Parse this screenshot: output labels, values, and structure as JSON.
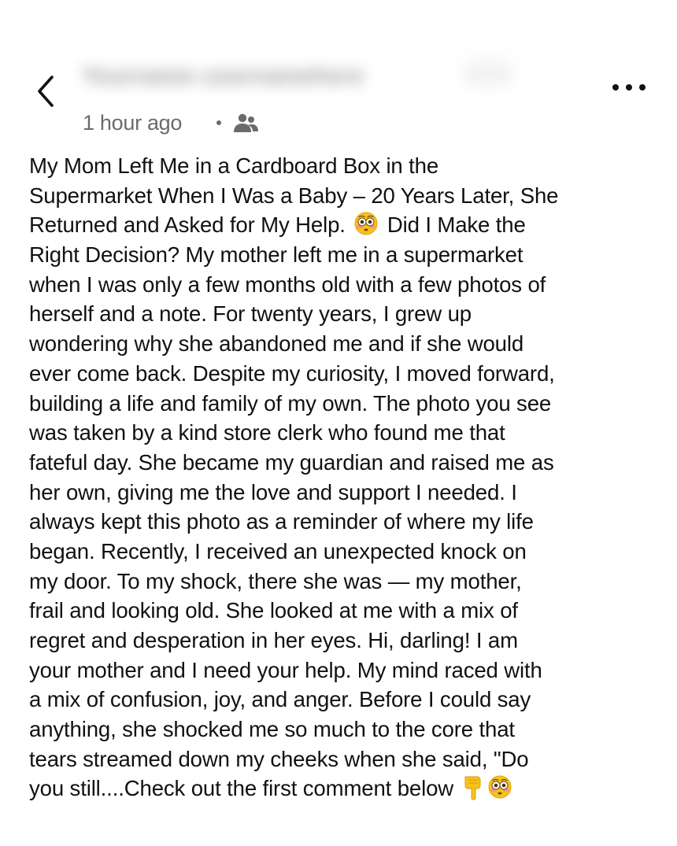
{
  "header": {
    "back_icon": "chevron-left-icon",
    "author_name_blurred": "Yourname usernamehere",
    "more_icon": "more-horizontal-icon",
    "timestamp": "1 hour ago",
    "audience_icon": "friends-icon"
  },
  "post": {
    "lines": [
      {
        "text": "My Mom Left Me in a Cardboard Box in the"
      },
      {
        "text": "Supermarket When I Was a Baby – 20 Years Later, She"
      },
      {
        "text": "Returned and Asked for My Help.",
        "emoji": "flushed-face-emoji",
        "after": "Did I Make the"
      },
      {
        "text": "Right Decision? My mother left me in a supermarket"
      },
      {
        "text": "when I was only a few months old with a few photos of"
      },
      {
        "text": "herself and a note. For twenty years, I grew up"
      },
      {
        "text": "wondering why she abandoned me and if she would"
      },
      {
        "text": "ever come back. Despite my curiosity, I moved forward,"
      },
      {
        "text": "building a life and family of my own. The photo you see"
      },
      {
        "text": "was taken by a kind store clerk who found me that"
      },
      {
        "text": "fateful day. She became my guardian and raised me as"
      },
      {
        "text": "her own, giving me the love and support I needed. I"
      },
      {
        "text": "always kept this photo as a reminder of where my life"
      },
      {
        "text": "began. Recently, I received an unexpected knock on"
      },
      {
        "text": "my door. To my shock, there she was — my mother,"
      },
      {
        "text": "frail and looking old. She looked at me with a mix of"
      },
      {
        "text": "regret and desperation in her eyes. Hi, darling! I am"
      },
      {
        "text": "your mother and I need your help. My mind raced with"
      },
      {
        "text": "a mix of confusion, joy, and anger. Before I could say"
      },
      {
        "text": "anything, she shocked me so much to the core that"
      },
      {
        "text": "tears streamed down my cheeks when she said, \"Do"
      },
      {
        "text": "you still....Check out the first comment below",
        "emoji_end": [
          "backhand-index-pointing-down-emoji",
          "flushed-face-emoji"
        ]
      }
    ]
  },
  "colors": {
    "text": "#111111",
    "meta_text": "#6b6b6b",
    "emoji_yellow": "#f7c21b"
  }
}
